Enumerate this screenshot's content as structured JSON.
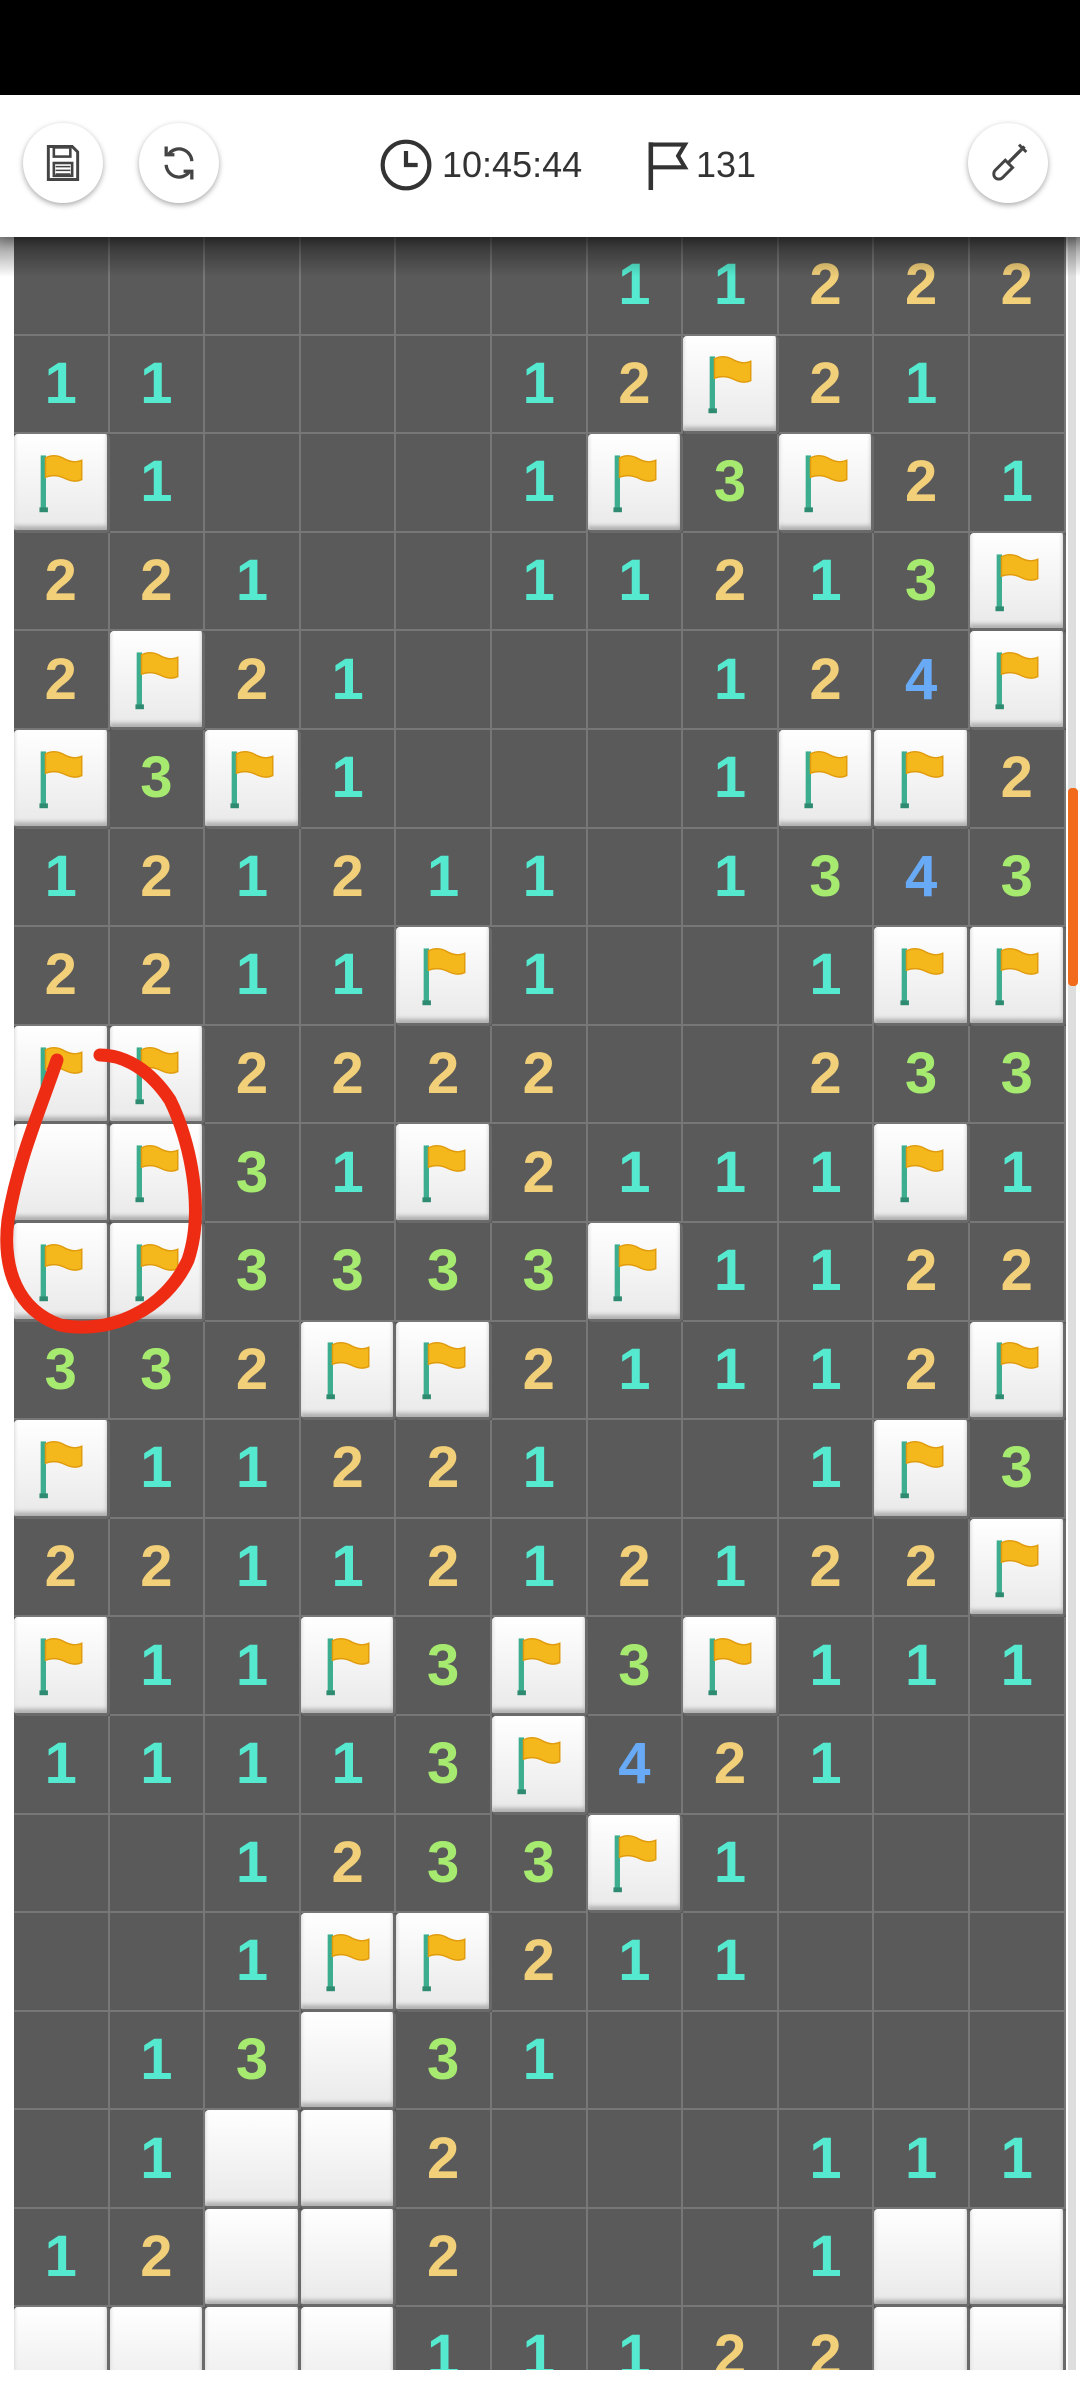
{
  "header": {
    "save_icon": "save-icon",
    "restart_icon": "restart-icon",
    "timer_icon": "clock-icon",
    "timer": "10:45:44",
    "flag_icon": "flag-outline-icon",
    "flags_count": "131",
    "tool_icon": "shovel-icon"
  },
  "colors": {
    "n1": "#55ead0",
    "n2": "#f2d07a",
    "n3": "#a6ea70",
    "n4": "#68aaf5",
    "open_cell": "#5a5a5a",
    "closed_cell": "#f4f4f4",
    "flag": "#f5b81c",
    "annotation": "#ee2c14",
    "scroll_thumb": "#f26a1b"
  },
  "board": {
    "columns": 11,
    "legend": "'.' = revealed empty, digit = revealed number, F = flagged covered cell, C = covered cell",
    "rows": [
      ". . . . . . 1 1 2 2 2",
      "1 1 . . . 1 2 F 2 1 .",
      "F 1 . . . 1 F 3 F 2 1",
      "2 2 1 . . 1 1 2 1 3 F",
      "2 F 2 1 . . . 1 2 4 F",
      "F 3 F 1 . . . 1 F F 2",
      "1 2 1 2 1 1 . 1 3 4 3",
      "2 2 1 1 F 1 . . 1 F F",
      "F F 2 2 2 2 . . 2 3 3",
      "C F 3 1 F 2 1 1 1 F 1",
      "F F 3 3 3 3 F 1 1 2 2",
      "3 3 2 F F 2 1 1 1 2 F",
      "F 1 1 2 2 1 . . 1 F 3",
      "2 2 1 1 2 1 2 1 2 2 F",
      "F 1 1 F 3 F 3 F 1 1 1",
      "1 1 1 1 3 F 4 2 1 . .",
      ". . 1 2 3 3 F 1 . . .",
      ". . 1 F F 2 1 1 . . .",
      ". 1 3 C 3 1 . . . . .",
      ". 1 C C 2 . . . 1 1 1",
      "1 2 C C 2 . . . 1 C C",
      "C C C C 1 1 1 2 2 C C"
    ]
  }
}
